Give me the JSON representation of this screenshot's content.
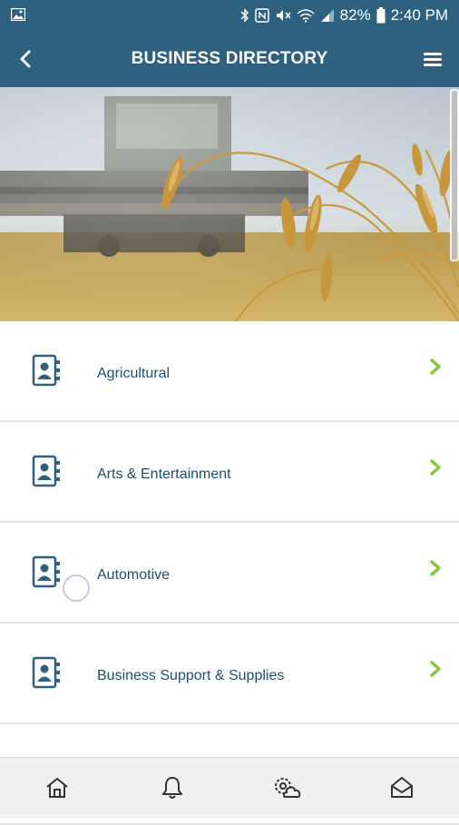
{
  "status_bar": {
    "battery_percent": "82%",
    "time": "2:40 PM",
    "icons": [
      "gallery-icon",
      "bluetooth-icon",
      "nfc-icon",
      "mute-icon",
      "wifi-icon",
      "signal-icon",
      "battery-icon"
    ]
  },
  "app_bar": {
    "title": "BUSINESS DIRECTORY",
    "back_icon": "chevron-left-icon",
    "menu_icon": "hamburger-menu-icon"
  },
  "hero": {
    "image": "wheat field with combine harvester"
  },
  "categories": [
    {
      "label": "Agricultural",
      "icon": "contact-book-icon"
    },
    {
      "label": "Arts & Entertainment",
      "icon": "contact-book-icon"
    },
    {
      "label": "Automotive",
      "icon": "contact-book-icon"
    },
    {
      "label": "Business Support & Supplies",
      "icon": "contact-book-icon"
    },
    {
      "label": "",
      "icon": "contact-book-icon"
    }
  ],
  "bottom_nav": [
    {
      "icon": "home-icon"
    },
    {
      "icon": "bell-icon"
    },
    {
      "icon": "weather-settings-icon"
    },
    {
      "icon": "mail-open-icon"
    }
  ],
  "colors": {
    "header": "#2e6180",
    "label_text": "#1f4f6e",
    "chevron": "#8cc63f",
    "bottom_bar": "#f0f0f0"
  }
}
